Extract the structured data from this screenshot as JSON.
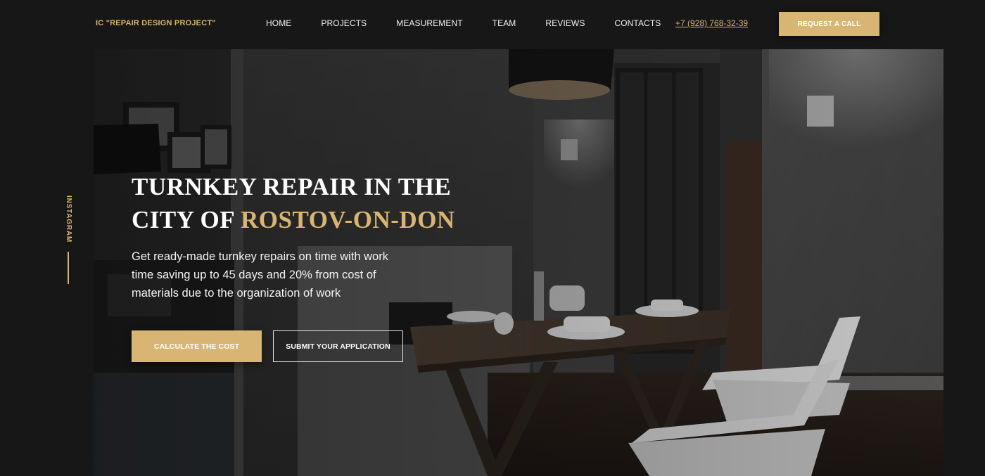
{
  "header": {
    "brand": "IC \"REPAIR DESIGN PROJECT\"",
    "nav": [
      "HOME",
      "PROJECTS",
      "MEASUREMENT",
      "TEAM",
      "REVIEWS",
      "CONTACTS"
    ],
    "phone": "+7 (928) 768-32-39",
    "request_button": "REQUEST A CALL"
  },
  "side": {
    "social_label": "INSTAGRAM"
  },
  "hero": {
    "title_line1": "TURNKEY REPAIR IN THE",
    "title_line2_prefix": "CITY OF ",
    "title_line2_accent": "ROSTOV-ON-DON",
    "description": "Get ready-made turnkey repairs on time with work time saving up to 45 days and 20% from cost of materials due to the organization of work",
    "primary_button": "CALCULATE THE COST",
    "secondary_button": "SUBMIT YOUR APPLICATION",
    "background_icon": "interior-dining-room-photo"
  },
  "colors": {
    "accent": "#d9b573",
    "background": "#171717",
    "text": "#ffffff"
  }
}
